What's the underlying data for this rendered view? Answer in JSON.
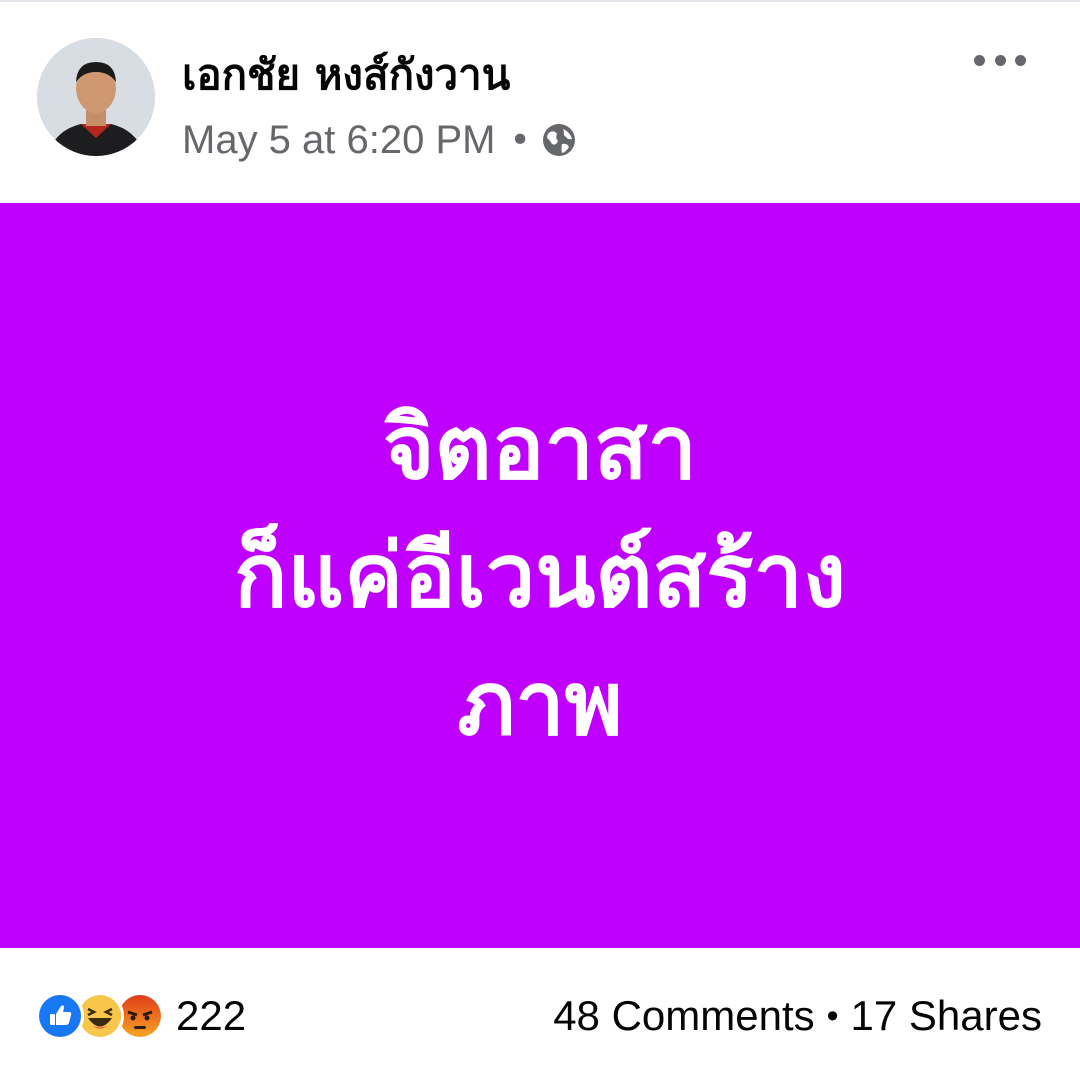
{
  "post": {
    "author": "เอกชัย หงส์กังวาน",
    "timestamp": "May 5 at 6:20 PM",
    "separator": "•",
    "privacy_icon": "globe-icon",
    "more_icon": "more-options-icon"
  },
  "content": {
    "background_color": "#c000fe",
    "text_color": "#ffffff",
    "lines": [
      "จิตอาสา",
      "ก็แค่อีเวนต์สร้าง",
      "ภาพ"
    ]
  },
  "stats": {
    "reaction_icons": [
      "like-icon",
      "haha-icon",
      "angry-icon"
    ],
    "reaction_count": "222",
    "comments": "48 Comments",
    "separator": "•",
    "shares": "17 Shares"
  }
}
